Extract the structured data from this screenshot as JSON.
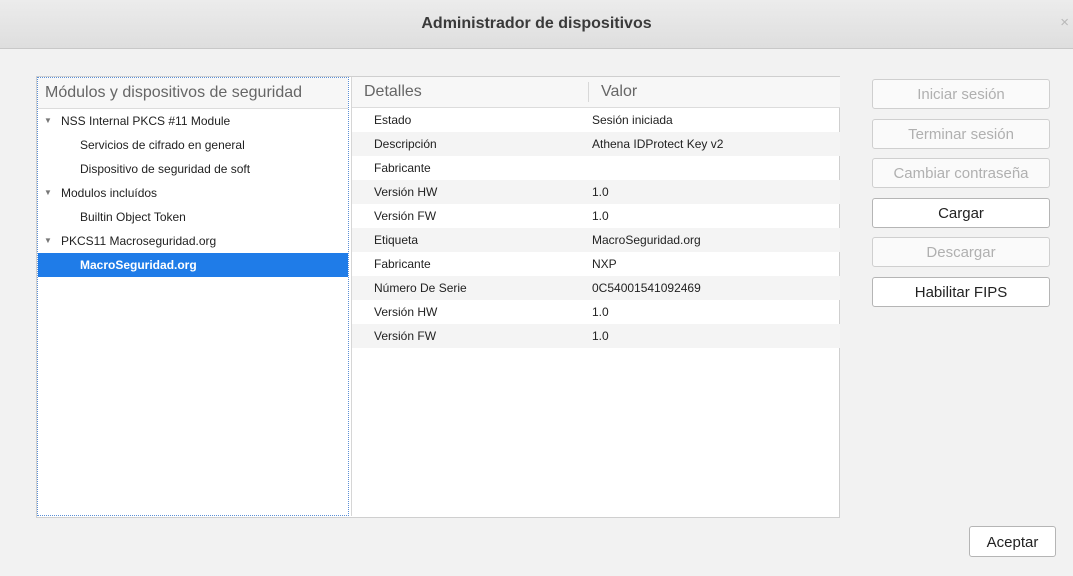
{
  "window": {
    "title": "Administrador de dispositivos",
    "close_glyph": "×"
  },
  "tree": {
    "header": "Módulos y dispositivos de seguridad",
    "items": [
      {
        "label": "NSS Internal PKCS #11 Module",
        "level": 0,
        "twisty": "▼"
      },
      {
        "label": "Servicios de cifrado en general",
        "level": 1
      },
      {
        "label": "Dispositivo de seguridad de soft",
        "level": 1
      },
      {
        "label": "Modulos incluídos",
        "level": 0,
        "twisty": "▼"
      },
      {
        "label": "Builtin Object Token",
        "level": 1
      },
      {
        "label": "PKCS11 Macroseguridad.org",
        "level": 0,
        "twisty": "▼"
      },
      {
        "label": "MacroSeguridad.org",
        "level": 1,
        "selected": true
      }
    ]
  },
  "details": {
    "col_detail": "Detalles",
    "col_value": "Valor",
    "rows": [
      {
        "key": "Estado",
        "value": "Sesión iniciada"
      },
      {
        "key": "Descripción",
        "value": "Athena IDProtect Key v2"
      },
      {
        "key": "Fabricante",
        "value": ""
      },
      {
        "key": "Versión HW",
        "value": "1.0"
      },
      {
        "key": "Versión FW",
        "value": "1.0"
      },
      {
        "key": "Etiqueta",
        "value": "MacroSeguridad.org"
      },
      {
        "key": "Fabricante",
        "value": "NXP"
      },
      {
        "key": "Número De Serie",
        "value": "0C54001541092469"
      },
      {
        "key": "Versión HW",
        "value": "1.0"
      },
      {
        "key": "Versión FW",
        "value": "1.0"
      }
    ]
  },
  "buttons": {
    "login": "Iniciar sesión",
    "logout": "Terminar sesión",
    "change_password": "Cambiar contraseña",
    "load": "Cargar",
    "unload": "Descargar",
    "enable_fips": "Habilitar FIPS",
    "accept": "Aceptar"
  },
  "colors": {
    "selection": "#1f7ce8",
    "disabled_text": "#b0b0b0"
  }
}
